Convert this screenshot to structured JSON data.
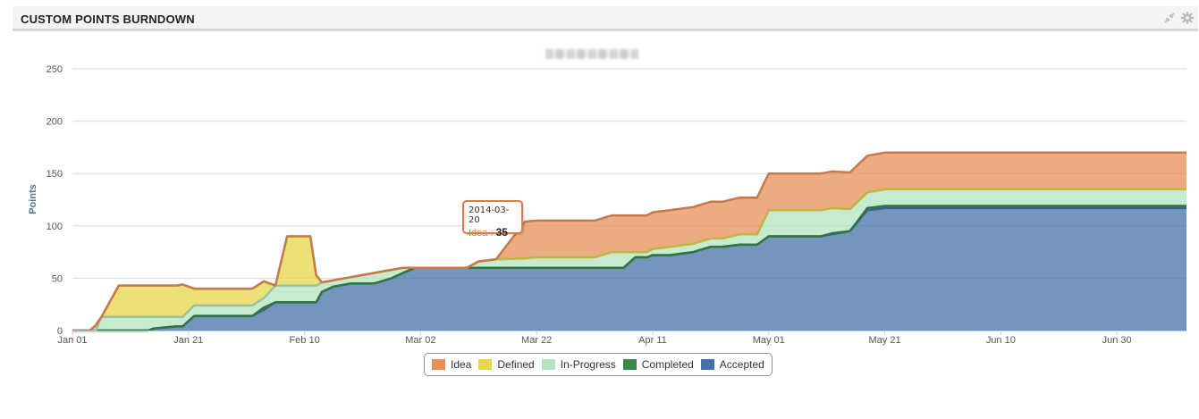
{
  "panel": {
    "title": "CUSTOM POINTS BURNDOWN",
    "icons": [
      "collapse-icon",
      "gear-icon"
    ]
  },
  "tooltip": {
    "date": "2014-03-20",
    "series": "Idea",
    "value": "35"
  },
  "chart_data": {
    "type": "area",
    "stacked": true,
    "ylabel": "Points",
    "ylim": [
      0,
      250
    ],
    "yticks": [
      0,
      50,
      100,
      150,
      200,
      250
    ],
    "x_start": "2014-01-01",
    "x_end": "2014-07-12",
    "xticks": [
      "Jan 01",
      "Jan 21",
      "Feb 10",
      "Mar 02",
      "Mar 22",
      "Apr 11",
      "May 01",
      "May 21",
      "Jun 10",
      "Jun 30"
    ],
    "grid": true,
    "legend_position": "bottom-center",
    "x": [
      "2014-01-01",
      "2014-01-04",
      "2014-01-05",
      "2014-01-06",
      "2014-01-09",
      "2014-01-14",
      "2014-01-15",
      "2014-01-19",
      "2014-01-20",
      "2014-01-22",
      "2014-01-24",
      "2014-01-27",
      "2014-01-29",
      "2014-02-01",
      "2014-02-03",
      "2014-02-05",
      "2014-02-07",
      "2014-02-10",
      "2014-02-11",
      "2014-02-12",
      "2014-02-13",
      "2014-02-15",
      "2014-02-18",
      "2014-02-20",
      "2014-02-22",
      "2014-02-25",
      "2014-02-27",
      "2014-03-01",
      "2014-03-02",
      "2014-03-05",
      "2014-03-10",
      "2014-03-12",
      "2014-03-15",
      "2014-03-20",
      "2014-03-22",
      "2014-03-25",
      "2014-03-28",
      "2014-03-30",
      "2014-04-01",
      "2014-04-04",
      "2014-04-06",
      "2014-04-08",
      "2014-04-10",
      "2014-04-11",
      "2014-04-14",
      "2014-04-18",
      "2014-04-21",
      "2014-04-23",
      "2014-04-26",
      "2014-04-29",
      "2014-05-01",
      "2014-05-05",
      "2014-05-08",
      "2014-05-10",
      "2014-05-12",
      "2014-05-15",
      "2014-05-18",
      "2014-05-21",
      "2014-05-25",
      "2014-06-01",
      "2014-06-10",
      "2014-06-20",
      "2014-06-30",
      "2014-07-12"
    ],
    "series": [
      {
        "name": "Accepted",
        "color": "#4572a7",
        "values": [
          0,
          0,
          0,
          0,
          0,
          0,
          2,
          4,
          4,
          14,
          14,
          14,
          14,
          14,
          20,
          27,
          27,
          27,
          27,
          27,
          37,
          42,
          45,
          45,
          45,
          50,
          55,
          60,
          60,
          60,
          60,
          60,
          60,
          60,
          60,
          60,
          60,
          60,
          60,
          60,
          60,
          70,
          70,
          72,
          72,
          75,
          80,
          80,
          82,
          82,
          90,
          90,
          90,
          90,
          92,
          95,
          115,
          117,
          117,
          117,
          117,
          117,
          117,
          117
        ]
      },
      {
        "name": "Completed",
        "color": "#3a8a4c",
        "values": [
          0,
          0,
          0,
          0,
          0,
          0,
          0,
          0,
          0,
          0,
          0,
          0,
          0,
          0,
          2,
          0,
          0,
          0,
          0,
          0,
          0,
          0,
          0,
          0,
          0,
          0,
          0,
          0,
          0,
          0,
          0,
          0,
          0,
          0,
          0,
          0,
          0,
          0,
          0,
          0,
          0,
          0,
          0,
          0,
          0,
          0,
          0,
          0,
          0,
          0,
          0,
          0,
          0,
          0,
          1,
          0,
          2,
          2,
          2,
          2,
          2,
          2,
          2,
          2
        ]
      },
      {
        "name": "In-Progress",
        "color": "#b3e4bf",
        "values": [
          0,
          0,
          0,
          13,
          13,
          13,
          11,
          9,
          9,
          10,
          10,
          10,
          10,
          10,
          9,
          16,
          16,
          16,
          16,
          16,
          9,
          6,
          6,
          8,
          10,
          8,
          5,
          0,
          0,
          0,
          0,
          6,
          8,
          9,
          10,
          10,
          10,
          10,
          10,
          15,
          15,
          5,
          5,
          6,
          8,
          8,
          8,
          8,
          10,
          10,
          25,
          25,
          25,
          25,
          24,
          21,
          15,
          16,
          16,
          16,
          16,
          16,
          16,
          16
        ]
      },
      {
        "name": "Defined",
        "color": "#e5d54a",
        "values": [
          0,
          0,
          5,
          0,
          30,
          30,
          30,
          30,
          31,
          16,
          16,
          16,
          16,
          16,
          16,
          0,
          47,
          47,
          47,
          10,
          0,
          0,
          0,
          0,
          0,
          0,
          0,
          0,
          0,
          0,
          0,
          0,
          0,
          0,
          0,
          0,
          0,
          0,
          0,
          0,
          0,
          0,
          0,
          0,
          0,
          0,
          0,
          0,
          0,
          0,
          0,
          0,
          0,
          0,
          0,
          0,
          0,
          0,
          0,
          0,
          0,
          0,
          0,
          0
        ]
      },
      {
        "name": "Idea",
        "color": "#e78f58",
        "values": [
          0,
          0,
          0,
          0,
          0,
          0,
          0,
          0,
          0,
          0,
          0,
          0,
          0,
          0,
          0,
          0,
          0,
          0,
          0,
          0,
          0,
          0,
          0,
          0,
          0,
          0,
          0,
          0,
          0,
          0,
          0,
          0,
          0,
          35,
          35,
          35,
          35,
          35,
          35,
          35,
          35,
          35,
          35,
          35,
          35,
          35,
          35,
          35,
          35,
          35,
          35,
          35,
          35,
          35,
          35,
          35,
          35,
          35,
          35,
          35,
          35,
          35,
          35,
          35
        ]
      }
    ]
  },
  "legend": [
    "Idea",
    "Defined",
    "In-Progress",
    "Completed",
    "Accepted"
  ]
}
